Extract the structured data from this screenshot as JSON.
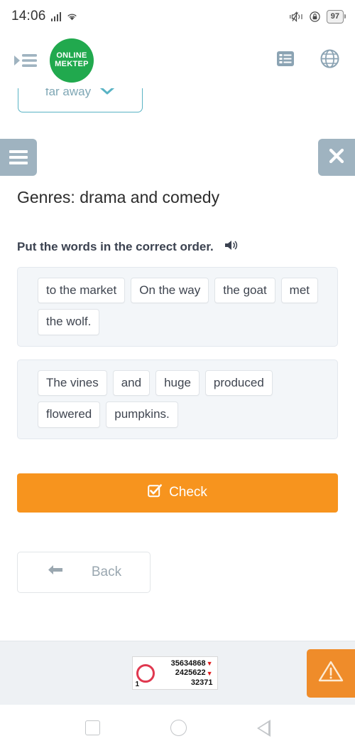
{
  "statusbar": {
    "time": "14:06",
    "signal_icon": "signal-bars-icon",
    "wifi_icon": "wifi-icon",
    "vibrate_icon": "vibrate-icon",
    "lock_icon": "screen-lock-icon",
    "battery_level": "97"
  },
  "header": {
    "menu_icon": "indent-menu-icon",
    "logo_line1": "ONLINE",
    "logo_line2": "MEKTEP",
    "list_icon": "list-view-icon",
    "globe_icon": "globe-language-icon"
  },
  "floating_select": {
    "value": "far away",
    "chevron_icon": "chevron-down-icon"
  },
  "banner": {
    "menu_button_icon": "hamburger-menu-icon",
    "close_button_icon": "close-x-icon",
    "close_label": "✖"
  },
  "lesson": {
    "title": "Genres: drama and comedy",
    "task_text": "Put the words in the correct order.",
    "audio_icon": "speaker-audio-icon"
  },
  "word_groups": [
    {
      "id": "sentence-1",
      "words": [
        "to the market",
        "On the way",
        "the goat",
        "met",
        "the wolf."
      ]
    },
    {
      "id": "sentence-2",
      "words": [
        "The vines",
        "and",
        "huge",
        "produced",
        "flowered",
        "pumpkins."
      ]
    }
  ],
  "actions": {
    "check_label": "Check",
    "check_icon": "checkbox-checked-icon",
    "check_color": "#f7941e",
    "back_label": "Back",
    "back_icon": "arrow-left-icon"
  },
  "footer": {
    "counter": {
      "circle_icon": "red-circle-icon",
      "rank": "1",
      "line1": "35634868",
      "line1_trend": "▼",
      "line2": "2425622",
      "line2_trend": "▼",
      "line3": "32371"
    },
    "warning_icon": "warning-triangle-icon",
    "warning_color": "#ef8c2a"
  },
  "navbar": {
    "recents_icon": "square-recents-icon",
    "home_icon": "circle-home-icon",
    "back_icon": "triangle-back-icon"
  }
}
